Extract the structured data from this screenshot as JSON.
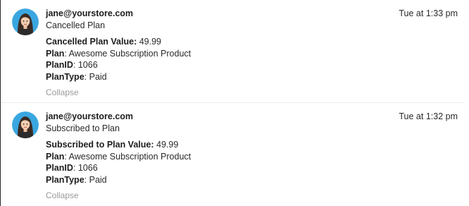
{
  "events": [
    {
      "email": "jane@yourstore.com",
      "action": "Cancelled Plan",
      "time": "Tue at 1:33 pm",
      "avatar_icon": "woman-avatar-icon",
      "properties": [
        {
          "key": "Cancelled Plan Value",
          "value": "49.99"
        },
        {
          "key": "Plan",
          "value": "Awesome Subscription Product"
        },
        {
          "key": "PlanID",
          "value": "1066"
        },
        {
          "key": "PlanType",
          "value": "Paid"
        }
      ],
      "collapse_label": "Collapse"
    },
    {
      "email": "jane@yourstore.com",
      "action": "Subscribed to Plan",
      "time": "Tue at 1:32 pm",
      "avatar_icon": "woman-avatar-icon",
      "properties": [
        {
          "key": "Subscribed to Plan Value",
          "value": "49.99"
        },
        {
          "key": "Plan",
          "value": "Awesome Subscription Product"
        },
        {
          "key": "PlanID",
          "value": "1066"
        },
        {
          "key": "PlanType",
          "value": "Paid"
        }
      ],
      "collapse_label": "Collapse"
    }
  ],
  "colors": {
    "avatar_bg": "#3aa6e0",
    "hair": "#3b2a22",
    "skin": "#f3cdb0",
    "shirt": "#2b2b2b",
    "muted_text": "#9a9a9a"
  }
}
